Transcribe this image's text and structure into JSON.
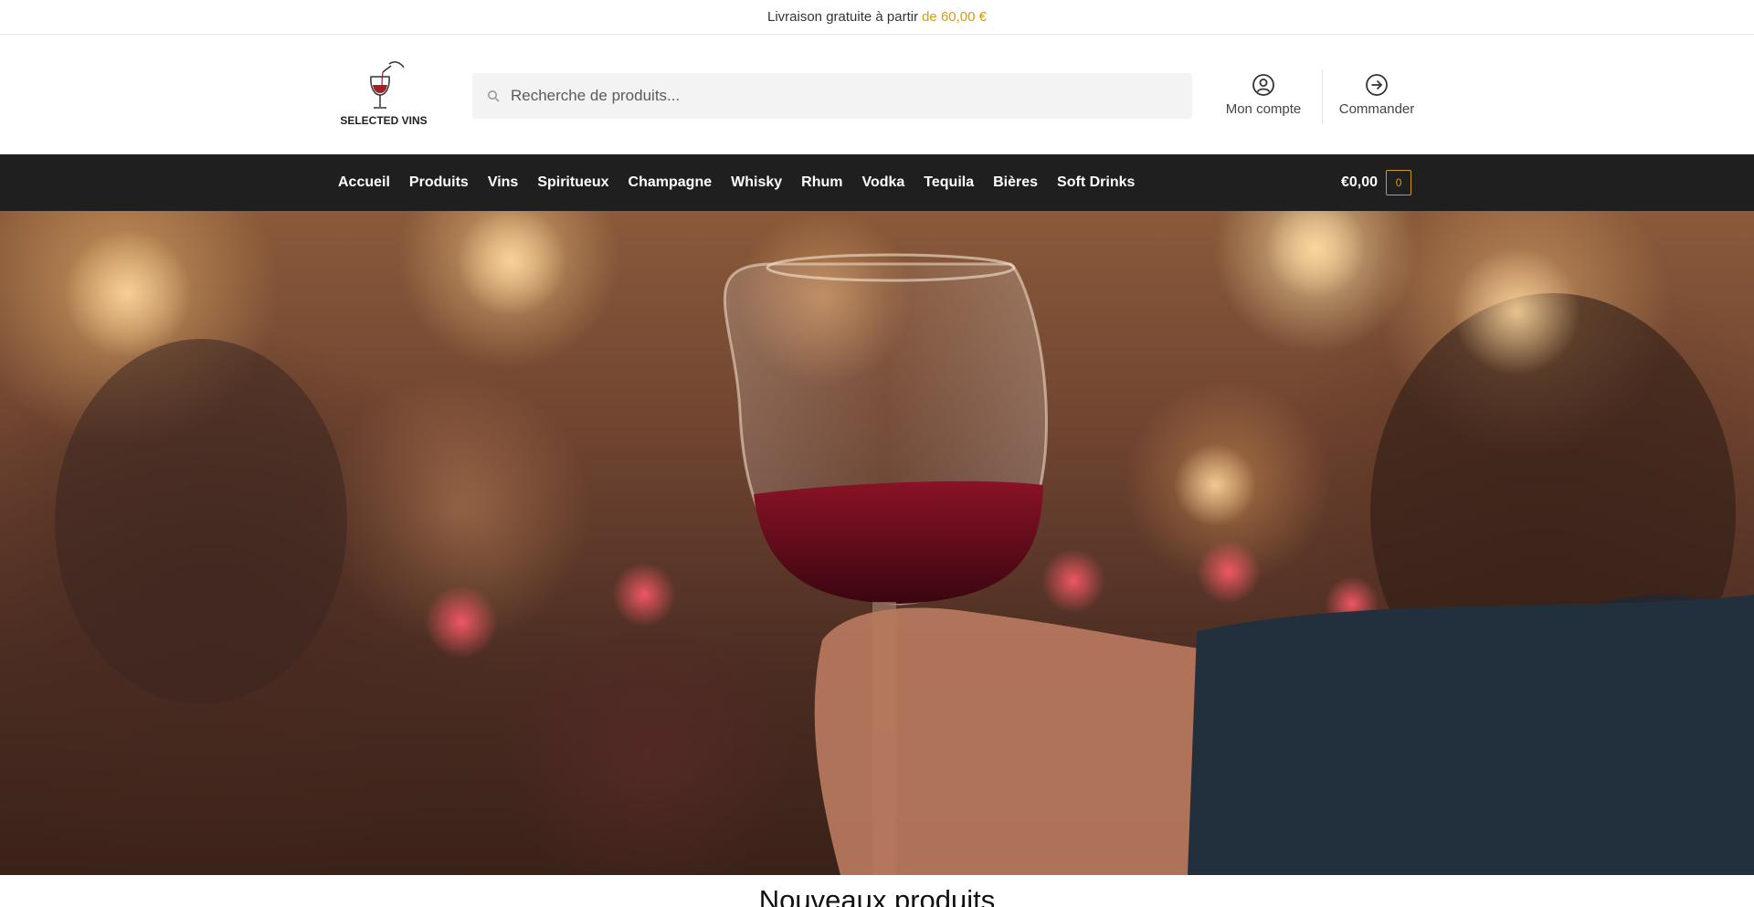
{
  "announcement": {
    "text": "Livraison gratuite à partir",
    "highlight": "de 60,00 €"
  },
  "logo": {
    "text": "SELECTED VINS"
  },
  "search": {
    "placeholder": "Recherche de produits..."
  },
  "header_links": {
    "account": "Mon compte",
    "checkout": "Commander"
  },
  "nav": {
    "items": [
      "Accueil",
      "Produits",
      "Vins",
      "Spiritueux",
      "Champagne",
      "Whisky",
      "Rhum",
      "Vodka",
      "Tequila",
      "Bières",
      "Soft Drinks"
    ]
  },
  "cart": {
    "amount": "€0,00",
    "count": "0"
  },
  "sections": {
    "new_products": "Nouveaux produits"
  },
  "colors": {
    "accent": "#d39b1a",
    "nav_bg": "#1f1f1f",
    "wine": "#7a0f1e"
  }
}
